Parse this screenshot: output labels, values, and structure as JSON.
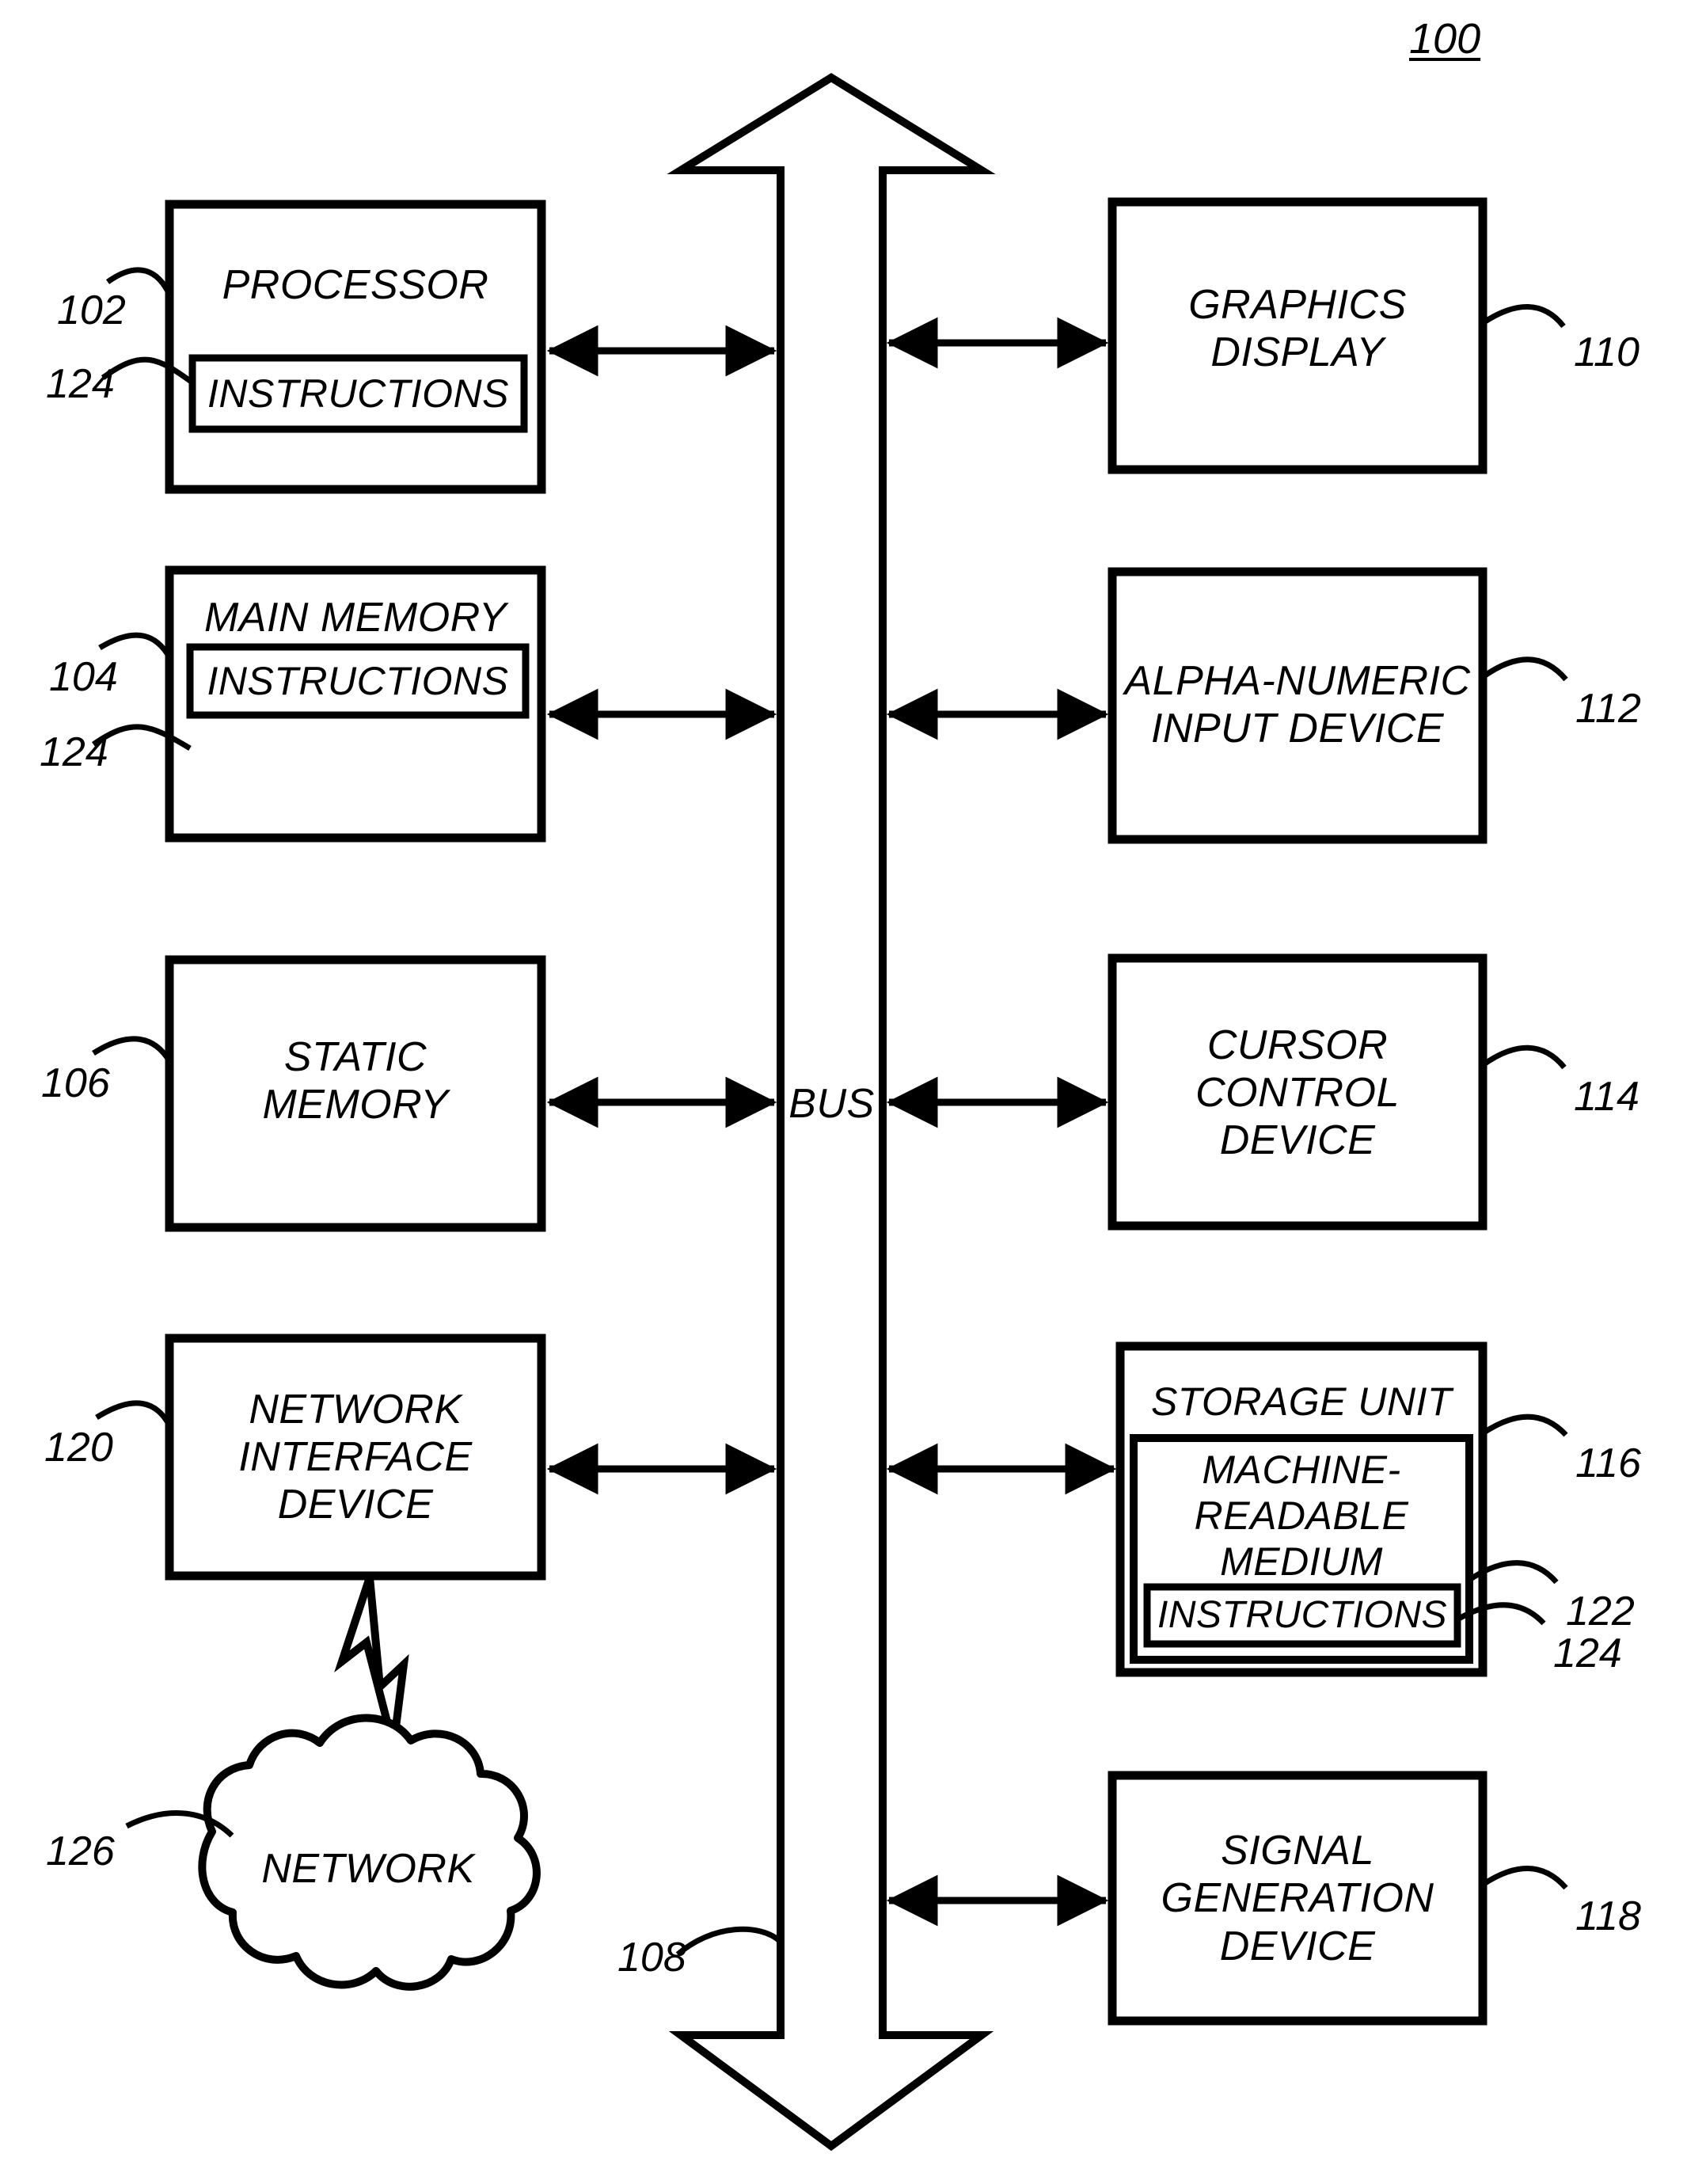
{
  "figure": {
    "number": "100",
    "type": "patent-block-diagram"
  },
  "bus": {
    "label": "BUS",
    "ref": "108"
  },
  "blocks": [
    {
      "id": "processor",
      "label": "PROCESSOR",
      "ref": "102",
      "column": "left",
      "sub": {
        "id": "processor-instructions",
        "label": "INSTRUCTIONS",
        "ref": "124"
      }
    },
    {
      "id": "main-memory",
      "label": "MAIN MEMORY",
      "ref": "104",
      "column": "left",
      "sub": {
        "id": "main-memory-instructions",
        "label": "INSTRUCTIONS",
        "ref": "124"
      }
    },
    {
      "id": "static-memory",
      "label": "STATIC\nMEMORY",
      "ref": "106",
      "column": "left",
      "sub": null
    },
    {
      "id": "network-interface-device",
      "label": "NETWORK\nINTERFACE\nDEVICE",
      "ref": "120",
      "column": "left",
      "sub": null
    },
    {
      "id": "graphics-display",
      "label": "GRAPHICS\nDISPLAY",
      "ref": "110",
      "column": "right",
      "sub": null
    },
    {
      "id": "alpha-numeric-input-device",
      "label": "ALPHA-NUMERIC\nINPUT DEVICE",
      "ref": "112",
      "column": "right",
      "sub": null
    },
    {
      "id": "cursor-control-device",
      "label": "CURSOR\nCONTROL\nDEVICE",
      "ref": "114",
      "column": "right",
      "sub": null
    },
    {
      "id": "storage-unit",
      "label": "STORAGE UNIT",
      "ref": "116",
      "column": "right",
      "sub": {
        "id": "machine-readable-medium",
        "label": "MACHINE-\nREADABLE\nMEDIUM",
        "ref": "122",
        "sub": {
          "id": "storage-instructions",
          "label": "INSTRUCTIONS",
          "ref": "124"
        }
      }
    },
    {
      "id": "signal-generation-device",
      "label": "SIGNAL\nGENERATION\nDEVICE",
      "ref": "118",
      "column": "right",
      "sub": null
    }
  ],
  "cloud": {
    "id": "network-cloud",
    "label": "NETWORK",
    "ref": "126"
  },
  "colors": {
    "stroke": "#000000",
    "background": "#ffffff"
  }
}
